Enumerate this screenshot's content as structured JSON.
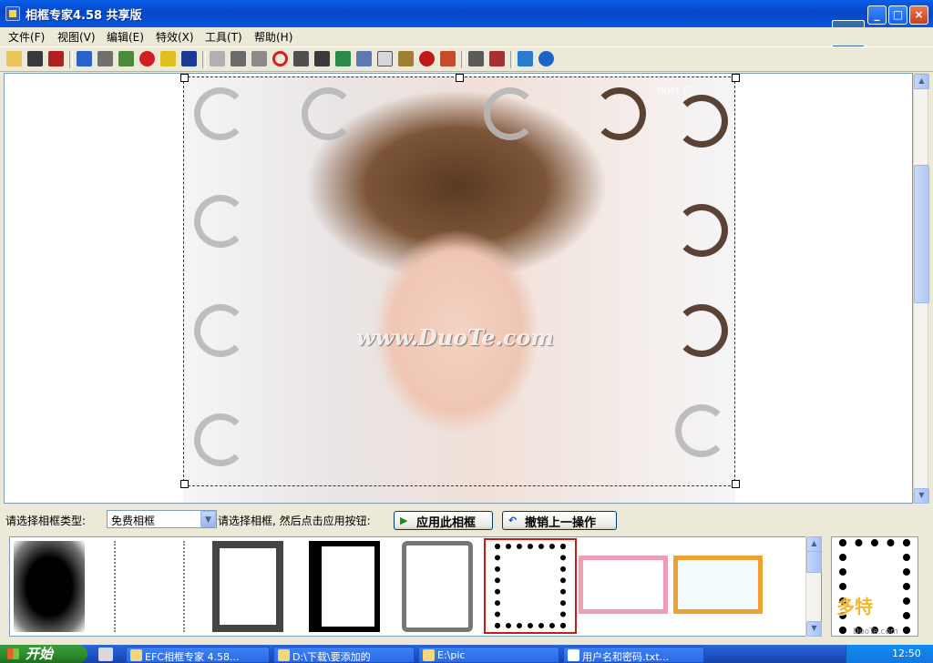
{
  "window": {
    "title": "相框专家4.58 共享版",
    "controls": {
      "minimize": "_",
      "maximize": "□",
      "close": "×"
    }
  },
  "menu": {
    "items": [
      {
        "label": "文件(F)"
      },
      {
        "label": "视图(V)"
      },
      {
        "label": "编辑(E)"
      },
      {
        "label": "特效(X)"
      },
      {
        "label": "工具(T)"
      },
      {
        "label": "帮助(H)"
      }
    ]
  },
  "toolbar": {
    "icons": [
      "open-icon",
      "save-icon",
      "save-as-icon",
      "undo-icon",
      "properties-icon",
      "crop-icon",
      "record-icon",
      "wand-icon",
      "text-icon",
      "rotate-select-icon",
      "effect-icon",
      "copy-icon",
      "redo-circle-icon",
      "glasses-icon",
      "camera-icon",
      "layers-icon",
      "frame-icon",
      "document-icon",
      "grid-icon",
      "stamp-icon",
      "brush-icon",
      "print-icon",
      "print-preview-icon",
      "cube-icon",
      "browser-icon"
    ],
    "colors": {
      "accent": "#1560e8"
    }
  },
  "canvas": {
    "watermark": "www.DuoTe.com",
    "signature": "nori C"
  },
  "controls": {
    "type_label": "请选择相框类型:",
    "type_value": "免费相框",
    "hint_label": "请选择相框, 然后点击应用按钮:",
    "apply_label": "应用此相框",
    "undo_label": "撤销上一操作"
  },
  "gallery": {
    "selected_index": 5,
    "selected_color": "#cc1a1a",
    "thumb_count": 8
  },
  "overlay_logo": {
    "brand": "多特",
    "sub": "DuoTe.com"
  },
  "taskbar": {
    "start_label": "开始",
    "tasks": [
      {
        "label": "EFC相框专家 4.58..."
      },
      {
        "label": "D:\\下载\\要添加的"
      },
      {
        "label": "E:\\pic"
      },
      {
        "label": "用户名和密码.txt..."
      }
    ],
    "clock": "12:50"
  }
}
